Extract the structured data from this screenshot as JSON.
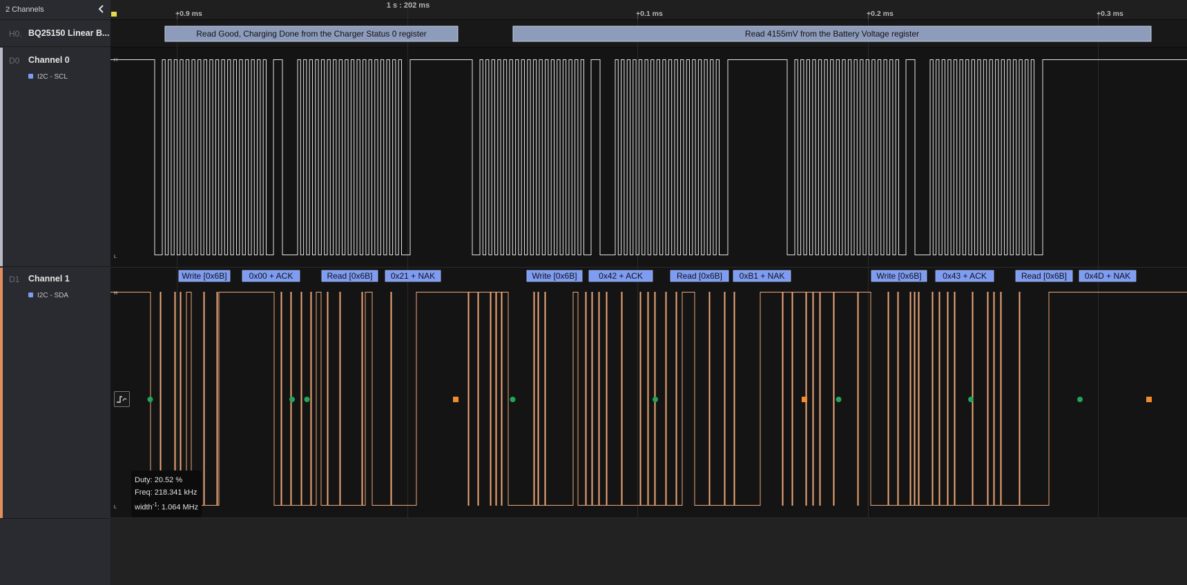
{
  "sidebar": {
    "title": "2 Channels",
    "rows": [
      {
        "id": "H0.",
        "name": "BQ25150 Linear B..."
      },
      {
        "id": "D0",
        "name": "Channel 0",
        "analyzer": "I2C - SCL"
      },
      {
        "id": "D1",
        "name": "Channel 1",
        "analyzer": "I2C - SDA"
      }
    ]
  },
  "timeline": {
    "center": "1 s : 202 ms",
    "ticks": [
      "+0.9 ms",
      "+0.1 ms",
      "+0.2 ms",
      "+0.3 ms"
    ]
  },
  "hla": [
    "Read Good, Charging Done from the Charger Status 0 register",
    "Read 4155mV from the Battery Voltage register"
  ],
  "i2c_frames": [
    "Write [0x6B]",
    "0x00 + ACK",
    "Read [0x6B]",
    "0x21 + NAK",
    "Write [0x6B]",
    "0x42 + ACK",
    "Read [0x6B]",
    "0xB1 + NAK",
    "Write [0x6B]",
    "0x43 + ACK",
    "Read [0x6B]",
    "0x4D + NAK"
  ],
  "levels": {
    "high": "H",
    "low": "L"
  },
  "measurement": {
    "duty": "Duty: 20.52 %",
    "freq": "Freq: 218.341 kHz",
    "width_prefix": "width",
    "width_sup": "-1",
    "width_value": ": 1.064 MHz"
  },
  "colors": {
    "scl_line": "#e6e6e6",
    "sda_line": "#f0a878",
    "hla_box": "#8e9cbc",
    "frame_box": "#7e9cf2",
    "start_marker": "#1fa658",
    "stop_marker": "#f28a30",
    "channel1_bar": "#e08e5c",
    "channel0_bar": "#b6bac4"
  }
}
